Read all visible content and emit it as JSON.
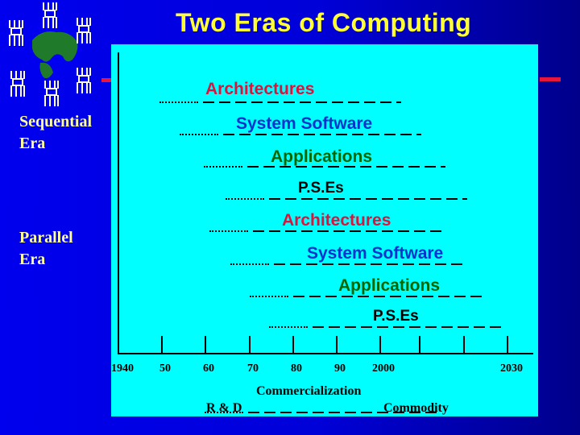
{
  "title": "Two Eras of Computing",
  "eras": [
    {
      "line1": "Sequential",
      "line2": "Era"
    },
    {
      "line1": "Parallel",
      "line2": "Era"
    }
  ],
  "colors": {
    "title": "#ffff33",
    "architectures": "#dc143c",
    "system_software": "#0033cc",
    "applications": "#006600",
    "pses": "#000000",
    "panel": "#00ffff"
  },
  "sequential_layers": [
    "Architectures",
    "System Software",
    "Applications",
    "P.S.Es"
  ],
  "parallel_layers": [
    "Architectures",
    "System Software",
    "Applications",
    "P.S.Es"
  ],
  "timeline": {
    "ticks": [
      "1940",
      "50",
      "60",
      "70",
      "80",
      "90",
      "2000",
      "2030"
    ],
    "phases": {
      "left": "R & D",
      "middle": "Commercialization",
      "right": "Commodity"
    }
  }
}
